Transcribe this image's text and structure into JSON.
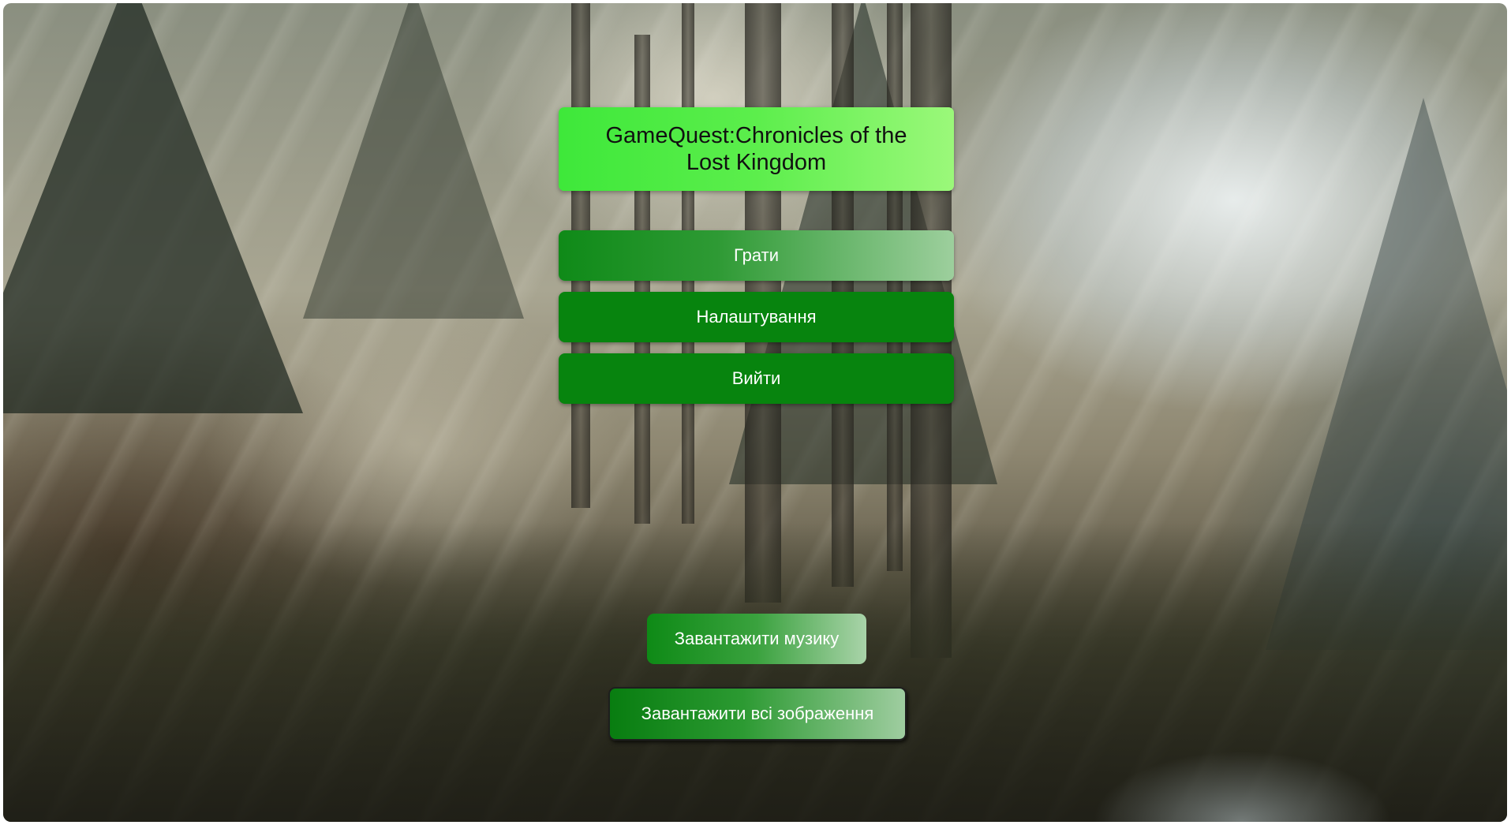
{
  "game": {
    "title": "GameQuest:Chronicles of the Lost Kingdom"
  },
  "menu": {
    "play_label": "Грати",
    "settings_label": "Налаштування",
    "exit_label": "Вийти"
  },
  "loaders": {
    "music_label": "Завантажити музику",
    "images_label": "Завантажити всі зображення"
  },
  "colors": {
    "title_bg_start": "#3ee83a",
    "title_bg_end": "#9bf87a",
    "button_green": "#07840e"
  }
}
